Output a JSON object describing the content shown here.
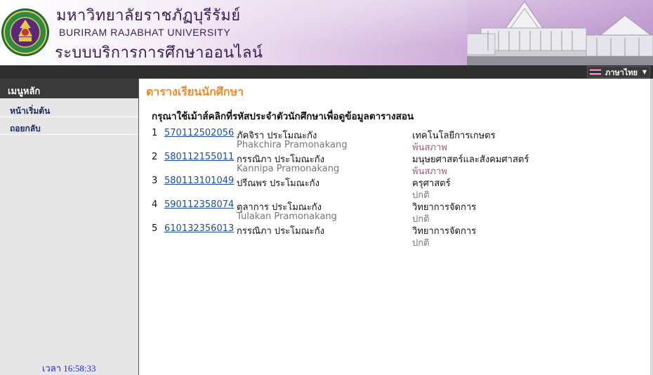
{
  "header": {
    "title_th": "มหาวิทยาลัยราชภัฏบุรีรัมย์",
    "title_en": "BURIRAM RAJABHAT UNIVERSITY",
    "system_name": "ระบบบริการการศึกษาออนไลน์"
  },
  "language": {
    "selected": "ภาษาไทย"
  },
  "sidebar": {
    "title": "เมนูหลัก",
    "items": [
      {
        "label": "หน้าเริ่มต้น"
      },
      {
        "label": "ถอยกลับ"
      }
    ],
    "clock": "เวลา 16:58:33"
  },
  "main": {
    "title": "ตารางเรียนนักศึกษา",
    "instruction": "กรุณาใช้เม้าส์คลิกที่รหัสประจำตัวนักศึกษาเพื่อดูข้อมูลตารางสอน",
    "students": [
      {
        "no": "1",
        "id": "570112502056",
        "name_th": "ภัคจิรา ประโมณะกัง",
        "name_en": "Phakchira Pramonakang",
        "faculty": "เทคโนโลยีการเกษตร",
        "status": "พ้นสภาพ",
        "status_color": "#a0606e"
      },
      {
        "no": "2",
        "id": "580112155011",
        "name_th": "กรรณิภา ประโมณะกัง",
        "name_en": "Kannipa Pramonakang",
        "faculty": "มนุษยศาสตร์และสังคมศาสตร์",
        "status": "พ้นสภาพ",
        "status_color": "#a0606e"
      },
      {
        "no": "3",
        "id": "580113101049",
        "name_th": "ปรีณพร ประโมณะกัง",
        "name_en": "",
        "faculty": "ครุศาสตร์",
        "status": "ปกติ",
        "status_color": "#777777"
      },
      {
        "no": "4",
        "id": "590112358074",
        "name_th": "ตุลาการ ประโมณะกัง",
        "name_en": "Tulakan Pramonakang",
        "faculty": "วิทยาการจัดการ",
        "status": "ปกติ",
        "status_color": "#777777"
      },
      {
        "no": "5",
        "id": "610132356013",
        "name_th": "กรรณิภา ประโมณะกัง",
        "name_en": "",
        "faculty": "วิทยาการจัดการ",
        "status": "ปกติ",
        "status_color": "#777777"
      }
    ]
  }
}
